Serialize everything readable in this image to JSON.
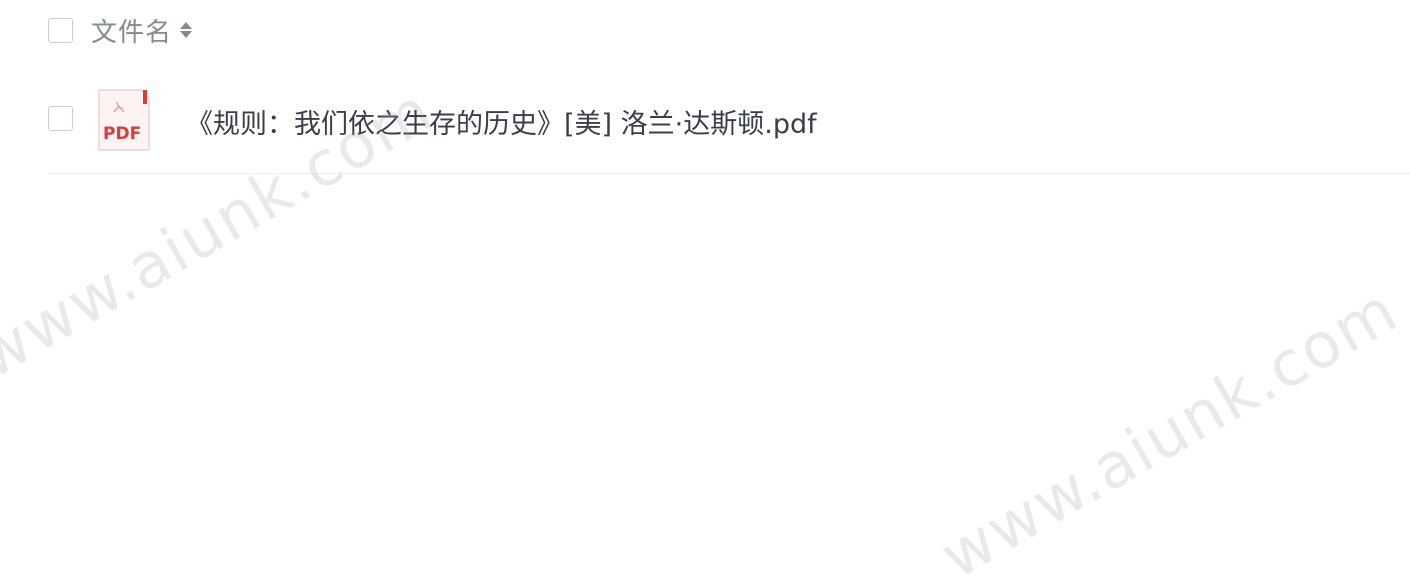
{
  "header": {
    "column_title": "文件名",
    "sort_icon": "sort-icon"
  },
  "files": [
    {
      "icon": "pdf-file-icon",
      "icon_text": "PDF",
      "name": "《规则：我们依之生存的历史》[美] 洛兰·达斯顿.pdf"
    }
  ],
  "watermark": {
    "text": "www.aiunk.com"
  },
  "colors": {
    "pdf_red": "#d93a3a",
    "text": "#3a3f47",
    "header_text": "#848a93"
  }
}
